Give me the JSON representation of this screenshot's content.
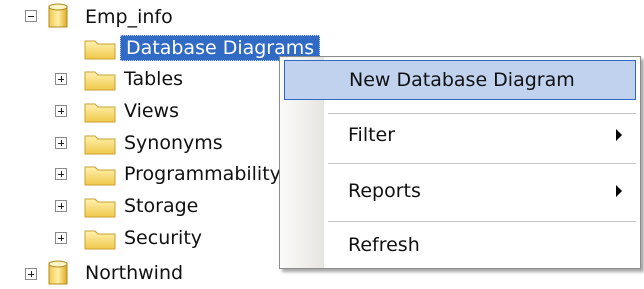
{
  "tree": {
    "root_db": "Emp_info",
    "items": [
      {
        "label": "Database Diagrams"
      },
      {
        "label": "Tables"
      },
      {
        "label": "Views"
      },
      {
        "label": "Synonyms"
      },
      {
        "label": "Programmability"
      },
      {
        "label": "Storage"
      },
      {
        "label": "Security"
      }
    ],
    "next_db": "Northwind"
  },
  "context_menu": {
    "items": [
      {
        "label": "New Database Diagram"
      },
      {
        "label": "Filter"
      },
      {
        "label": "Reports"
      },
      {
        "label": "Refresh"
      }
    ]
  },
  "colors": {
    "selection": "#316ac5",
    "menu_hover": "#c1d2ee",
    "folder": "#f5d66c"
  }
}
